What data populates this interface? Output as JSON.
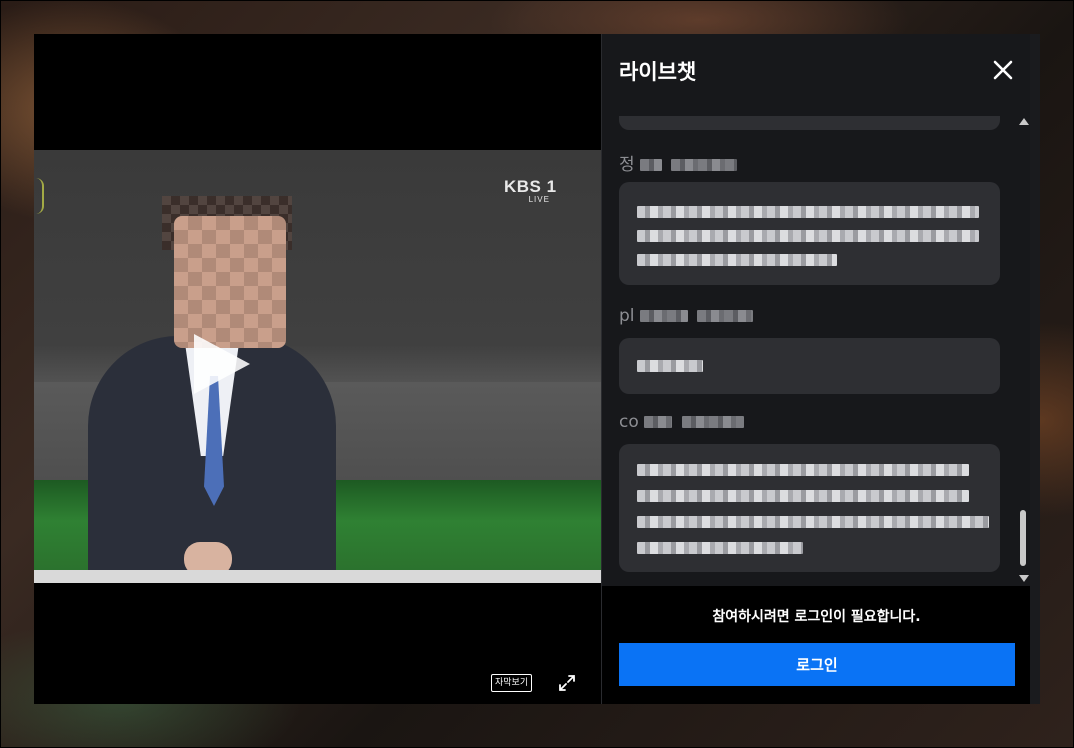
{
  "video": {
    "channel_logo": "KBS 1",
    "channel_sub": "LIVE",
    "subtitle_button_label": "자막보기",
    "icons": {
      "play": "play-icon",
      "fullscreen": "fullscreen-icon"
    }
  },
  "chat": {
    "title": "라이브챗",
    "close_icon": "close-icon",
    "messages": [
      {
        "user_prefix": "정"
      },
      {
        "user_prefix": "pl"
      },
      {
        "user_prefix": "co"
      }
    ],
    "login_notice": "참여하시려면 로그인이 필요합니다.",
    "login_button_label": "로그인"
  },
  "colors": {
    "accent": "#0a73f5",
    "panel_bg": "#17181b",
    "bubble_bg": "#2e2f33"
  }
}
